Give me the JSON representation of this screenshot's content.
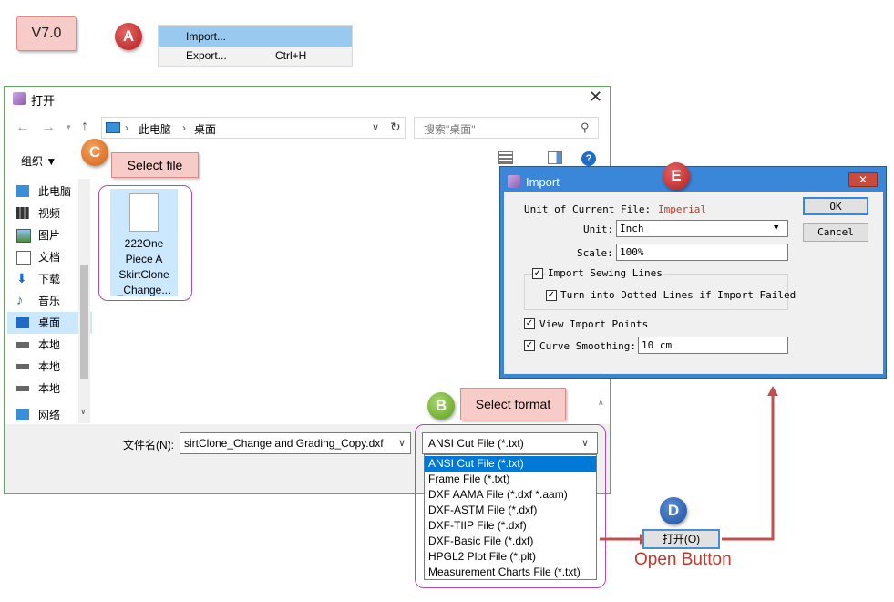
{
  "version_tag": "V7.0",
  "callouts": {
    "a": "A",
    "b": "B",
    "c": "C",
    "d": "D",
    "e": "E"
  },
  "top_menu": {
    "import_label": "Import...",
    "export_label": "Export...",
    "export_shortcut": "Ctrl+H"
  },
  "open_dialog": {
    "title": "打开",
    "address": {
      "root": "此电脑",
      "folder": "桌面"
    },
    "search_placeholder": "搜索\"桌面\"",
    "organize_label": "组织 ▼",
    "sidebar": [
      {
        "label": "此电脑",
        "icon": "computer-icon"
      },
      {
        "label": "视频",
        "icon": "video-icon"
      },
      {
        "label": "图片",
        "icon": "pictures-icon"
      },
      {
        "label": "文档",
        "icon": "documents-icon"
      },
      {
        "label": "下载",
        "icon": "download-icon"
      },
      {
        "label": "音乐",
        "icon": "music-icon"
      },
      {
        "label": "桌面",
        "icon": "desktop-icon"
      },
      {
        "label": "本地",
        "icon": "drive-icon"
      },
      {
        "label": "本地",
        "icon": "drive-icon"
      },
      {
        "label": "本地",
        "icon": "drive-icon"
      },
      {
        "label": "网络",
        "icon": "network-icon"
      }
    ],
    "file": {
      "line1": "222One",
      "line2": "Piece A",
      "line3": "SkirtClone",
      "line4": "_Change..."
    },
    "filename_label": "文件名(N):",
    "filename_value": "sirtClone_Change and Grading_Copy.dxf",
    "filetype_selected": "ANSI Cut File (*.txt)",
    "filetype_options": [
      "ANSI Cut File (*.txt)",
      "Frame File (*.txt)",
      "DXF AAMA File (*.dxf *.aam)",
      "DXF-ASTM File (*.dxf)",
      "DXF-TIIP File (*.dxf)",
      "DXF-Basic File (*.dxf)",
      "HPGL2 Plot File (*.plt)",
      "Measurement Charts File (*.txt)"
    ],
    "open_button": "打开(O)"
  },
  "annotations": {
    "select_file": "Select file",
    "select_format": "Select format",
    "open_button_caption": "Open Button"
  },
  "import_dialog": {
    "title": "Import",
    "unit_of_file_label": "Unit of Current File:",
    "unit_of_file_value": "Imperial",
    "unit_label": "Unit:",
    "unit_value": "Inch",
    "scale_label": "Scale:",
    "scale_value": "100%",
    "import_sewing_lines": "Import Sewing Lines",
    "dotted_lines": "Turn into Dotted Lines if Import Failed",
    "view_import_points": "View Import Points",
    "curve_smoothing": "Curve Smoothing:",
    "curve_smoothing_value": "10 cm",
    "ok": "OK",
    "cancel": "Cancel"
  },
  "colors": {
    "accent_red": "#c0392b",
    "arrow": "#c0504d",
    "select_blue": "#0078d7",
    "title_blue": "#3a86d8"
  }
}
